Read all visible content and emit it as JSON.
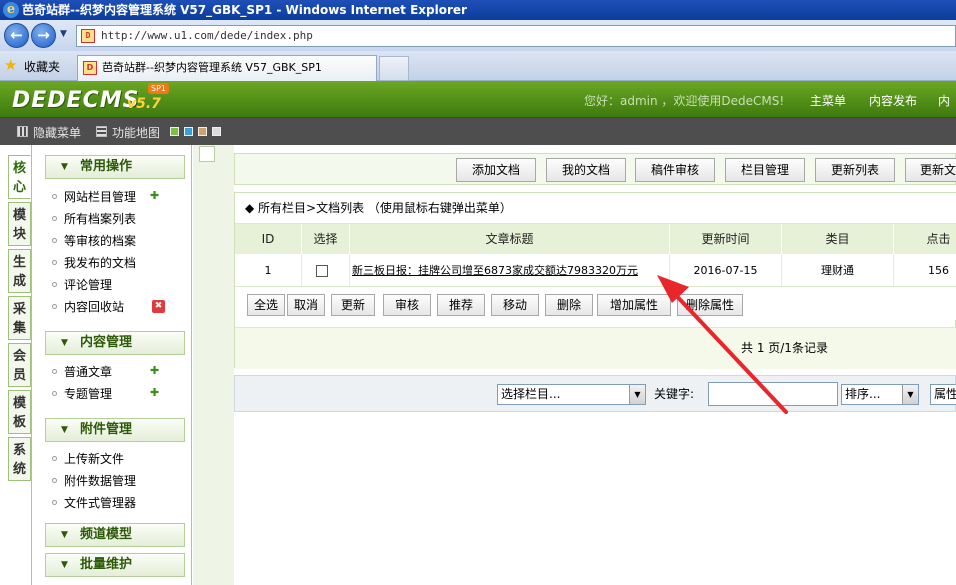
{
  "window": {
    "title": "芭奇站群--织梦内容管理系统 V57_GBK_SP1 - Windows Internet Explorer",
    "ie_logo": "e"
  },
  "browser": {
    "back_glyph": "←",
    "forward_glyph": "→",
    "url": "http://www.u1.com/dede/index.php",
    "favorites_label": "收藏夹",
    "tab_title": "芭奇站群--织梦内容管理系统 V57_GBK_SP1"
  },
  "header": {
    "logo": "DEDECMS",
    "version": "v5.7",
    "sp_badge": "SP1",
    "welcome": "您好：admin ，欢迎使用DedeCMS!",
    "nav": [
      "主菜单",
      "内容发布",
      "内"
    ]
  },
  "toolbar": {
    "hide_menu": "隐藏菜单",
    "site_map": "功能地图"
  },
  "side_tabs": [
    "核心",
    "模块",
    "生成",
    "采集",
    "会员",
    "模板",
    "系统"
  ],
  "sidebar": {
    "sections": [
      {
        "title": "常用操作",
        "items": [
          "网站栏目管理",
          "所有档案列表",
          "等审核的档案",
          "我发布的文档",
          "评论管理",
          "内容回收站"
        ]
      },
      {
        "title": "内容管理",
        "items": [
          "普通文章",
          "专题管理"
        ]
      },
      {
        "title": "附件管理",
        "items": [
          "上传新文件",
          "附件数据管理",
          "文件式管理器"
        ]
      },
      {
        "title": "频道模型",
        "items": []
      },
      {
        "title": "批量维护",
        "items": []
      }
    ]
  },
  "top_buttons": [
    "添加文档",
    "我的文档",
    "稿件审核",
    "栏目管理",
    "更新列表",
    "更新文"
  ],
  "list": {
    "breadcrumb": "◆ 所有栏目>文档列表  （使用鼠标右键弹出菜单）",
    "columns": [
      "ID",
      "选择",
      "文章标题",
      "更新时间",
      "类目",
      "点击"
    ],
    "rows": [
      {
        "id": "1",
        "title": "新三板日报：挂牌公司增至6873家成交额达7983320万元",
        "updated": "2016-07-15",
        "category": "理财通",
        "clicks": "156"
      }
    ],
    "actions": [
      "全选",
      "取消",
      "更新",
      "审核",
      "推荐",
      "移动",
      "删除",
      "增加属性",
      "删除属性"
    ],
    "pagination": "共 1 页/1条记录"
  },
  "filter": {
    "column_select": "选择栏目...",
    "keyword_label": "关键字:",
    "sort_select": "排序...",
    "attr_select": "属性"
  },
  "colors": {
    "header_green": "#4e8f18",
    "annotation_arrow": "#e8262b"
  }
}
